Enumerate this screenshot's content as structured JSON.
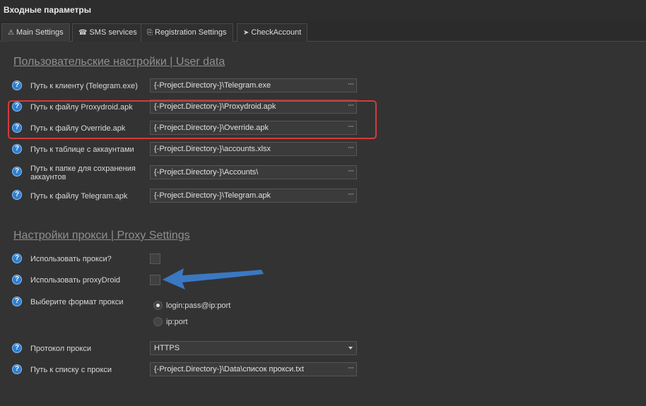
{
  "window": {
    "title": "Входные параметры"
  },
  "tabs": [
    {
      "label": "Main Settings",
      "icon": "warning-icon",
      "glyph": "⚠",
      "active": true
    },
    {
      "label": "SMS services",
      "icon": "sms-icon",
      "glyph": "☎",
      "active": false
    },
    {
      "label": "Registration Settings",
      "icon": "document-icon",
      "glyph": "⎘",
      "active": false
    },
    {
      "label": "CheckAccount",
      "icon": "send-icon",
      "glyph": "➤",
      "active": false
    }
  ],
  "user_data": {
    "title": "Пользовательские настройки | User data",
    "fields": [
      {
        "label": "Путь к клиенту (Telegram.exe)",
        "value": "{-Project.Directory-}\\Telegram.exe"
      },
      {
        "label": "Путь к файлу Proxydroid.apk",
        "value": "{-Project.Directory-}\\Proxydroid.apk"
      },
      {
        "label": "Путь к файлу Override.apk",
        "value": "{-Project.Directory-}\\Override.apk"
      },
      {
        "label": "Путь к таблице с аккаунтами",
        "value": "{-Project.Directory-}\\accounts.xlsx"
      },
      {
        "label": "Путь к папке для сохранения аккаунтов",
        "value": "{-Project.Directory-}\\Accounts\\"
      },
      {
        "label": "Путь к файлу Telegram.apk",
        "value": "{-Project.Directory-}\\Telegram.apk"
      }
    ],
    "browse_label": "···"
  },
  "proxy": {
    "title": "Настройки прокси | Proxy Settings",
    "use_proxy_label": "Использовать прокси?",
    "use_proxy_checked": false,
    "use_proxydroid_label": "Использовать proxyDroid",
    "use_proxydroid_checked": false,
    "format_label": "Выберите формат прокси",
    "format_options": [
      {
        "label": "login:pass@ip:port",
        "checked": true
      },
      {
        "label": "ip:port",
        "checked": false
      }
    ],
    "protocol_label": "Протокол прокси",
    "protocol_value": "HTTPS",
    "list_label": "Путь к списку с прокси",
    "list_value": "{-Project.Directory-}\\Data\\список прокси.txt"
  },
  "help_glyph": "?",
  "colors": {
    "highlight": "#d23c3c",
    "arrow": "#3a78c2",
    "help": "#2e7fd1"
  }
}
